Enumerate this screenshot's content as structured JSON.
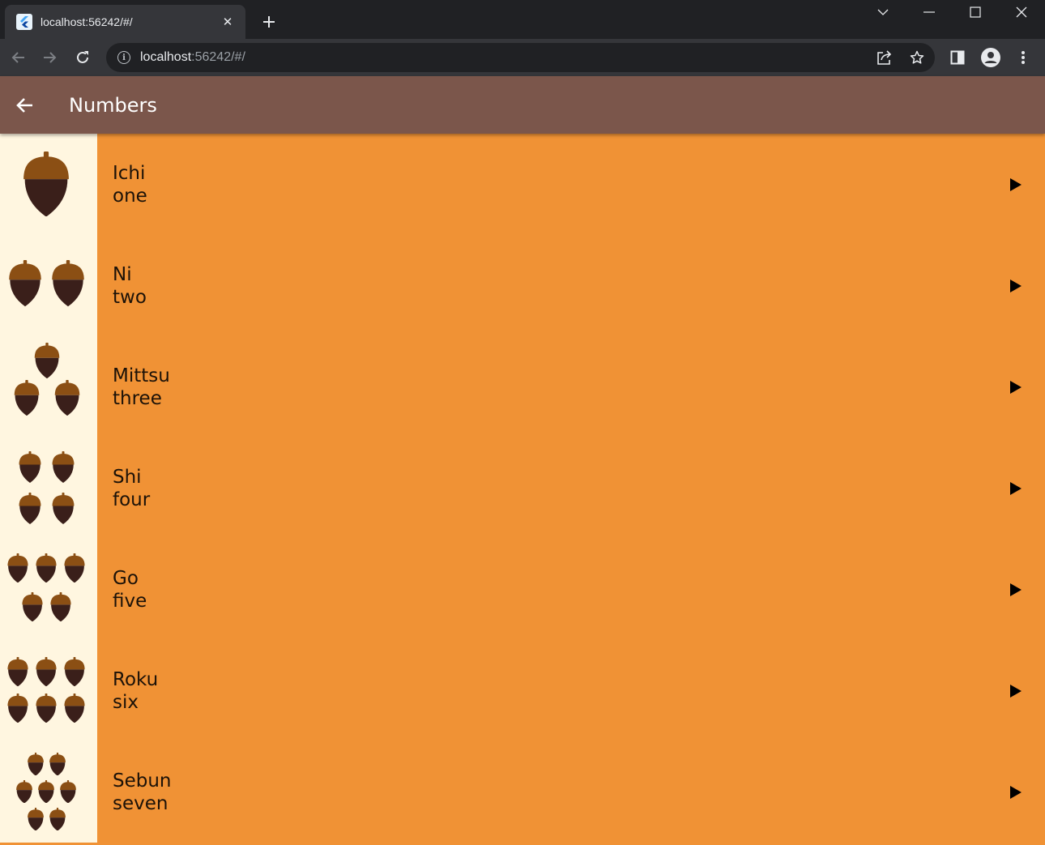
{
  "browser": {
    "tab_title": "localhost:56242/#/",
    "url_host": "localhost",
    "url_rest": ":56242/#/"
  },
  "app": {
    "title": "Numbers",
    "items": [
      {
        "japanese": "Ichi",
        "english": "one",
        "count": 1
      },
      {
        "japanese": "Ni",
        "english": "two",
        "count": 2
      },
      {
        "japanese": "Mittsu",
        "english": "three",
        "count": 3
      },
      {
        "japanese": "Shi",
        "english": "four",
        "count": 4
      },
      {
        "japanese": "Go",
        "english": "five",
        "count": 5
      },
      {
        "japanese": "Roku",
        "english": "six",
        "count": 6
      },
      {
        "japanese": "Sebun",
        "english": "seven",
        "count": 7
      }
    ]
  },
  "colors": {
    "appbar": "#7b564b",
    "list_bg": "#f09235",
    "image_bg": "#fff6e0",
    "acorn_cap": "#8b4f14",
    "acorn_body": "#3a1f1a"
  },
  "icons": {
    "back": "arrow-left-icon",
    "play": "play-arrow-icon",
    "acorn": "acorn-icon"
  }
}
